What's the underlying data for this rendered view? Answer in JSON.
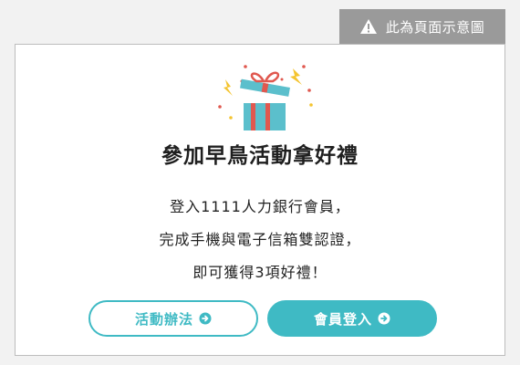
{
  "notice": {
    "label": "此為頁面示意圖",
    "icon": "warning-icon"
  },
  "popup": {
    "illustration": "gift-box-icon",
    "title": "參加早鳥活動拿好禮",
    "description_lines": [
      "登入1111人力銀行會員，",
      "完成手機與電子信箱雙認證，",
      "即可獲得3項好禮！"
    ],
    "buttons": {
      "secondary_label": "活動辦法",
      "primary_label": "會員登入",
      "arrow_icon": "arrow-right-circle-icon"
    }
  },
  "colors": {
    "accent": "#3fbac4",
    "gift_box": "#5bbfcc",
    "ribbon": "#e0584f",
    "spark": "#f4c430",
    "notice_bg": "#9a9a9a"
  }
}
